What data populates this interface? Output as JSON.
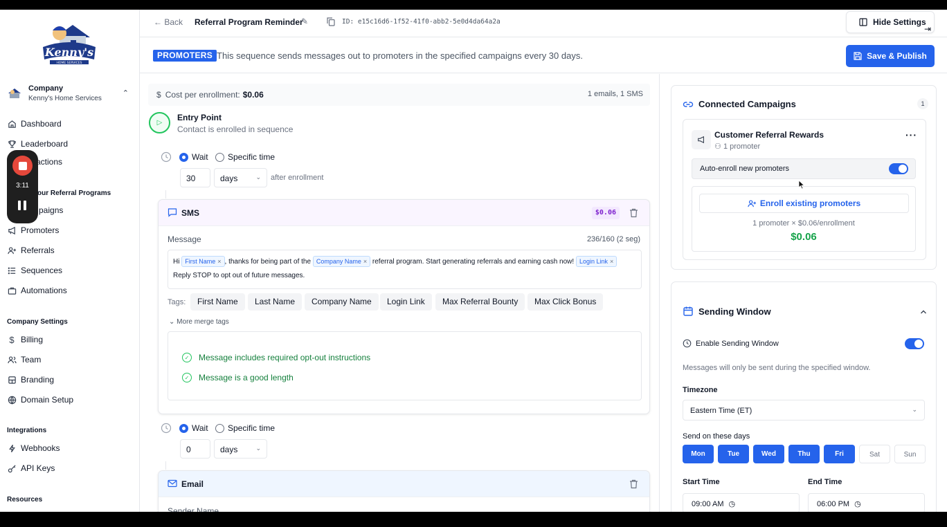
{
  "sidebar": {
    "company": {
      "label": "Company",
      "name": "Kenny's Home Services"
    },
    "nav": [
      {
        "label": "Dashboard",
        "icon": "home-icon"
      },
      {
        "label": "Leaderboard",
        "icon": "trophy-icon"
      },
      {
        "label": "sactions",
        "icon": "transactions-icon"
      },
      {
        "label": "paigns",
        "icon": "campaigns-icon"
      },
      {
        "label": "Promoters",
        "icon": "megaphone-icon"
      },
      {
        "label": "Referrals",
        "icon": "user-plus-icon"
      },
      {
        "label": "Sequences",
        "icon": "list-icon"
      },
      {
        "label": "Automations",
        "icon": "briefcase-icon"
      }
    ],
    "section_programs": "our Referral Programs",
    "section_company": "Company Settings",
    "company_nav": [
      {
        "label": "Billing",
        "icon": "dollar-icon"
      },
      {
        "label": "Team",
        "icon": "users-icon"
      },
      {
        "label": "Branding",
        "icon": "palette-icon"
      },
      {
        "label": "Domain Setup",
        "icon": "globe-icon"
      }
    ],
    "section_integrations": "Integrations",
    "integration_nav": [
      {
        "label": "Webhooks",
        "icon": "webhook-icon"
      },
      {
        "label": "API Keys",
        "icon": "key-icon"
      }
    ],
    "section_resources": "Resources"
  },
  "recorder": {
    "time": "3:11"
  },
  "topbar": {
    "back": "Back",
    "title": "Referral Program Reminder",
    "id": "ID: e15c16d6-1f52-41f0-abb2-5e0d4da64a2a",
    "hide_settings": "Hide Settings"
  },
  "info": {
    "badge": "PROMOTERS",
    "text": "This sequence sends messages out to promoters in the specified campaigns every 30 days.",
    "save": "Save & Publish"
  },
  "sequence": {
    "cost_label": "Cost per enrollment:",
    "cost_value": "$0.06",
    "counts": "1 emails, 1 SMS",
    "entry_title": "Entry Point",
    "entry_sub": "Contact is enrolled in sequence",
    "wait_label": "Wait",
    "specific_label": "Specific time",
    "wait1": {
      "value": "30",
      "unit": "days",
      "after": "after enrollment"
    },
    "wait2": {
      "value": "0",
      "unit": "days"
    },
    "sms": {
      "title": "SMS",
      "price": "$0.06",
      "message_label": "Message",
      "count": "236/160 (2 seg)",
      "msg_hi": "Hi",
      "chip_first": "First Name",
      "msg_part2": ", thanks for being part of the",
      "chip_company": "Company Name",
      "msg_part3": "referral program. Start generating referrals and earning cash now!",
      "chip_login": "Login Link",
      "msg_line2": "Reply STOP to opt out of future messages.",
      "chip_close": "×",
      "tags_label": "Tags:",
      "tags": [
        "First Name",
        "Last Name",
        "Company Name",
        "Login Link",
        "Max Referral Bounty",
        "Max Click Bonus"
      ],
      "more_tags": "More merge tags",
      "checks": [
        "Message includes required opt-out instructions",
        "Message is a good length"
      ]
    },
    "email": {
      "title": "Email",
      "sender_label": "Sender Name"
    }
  },
  "connected": {
    "title": "Connected Campaigns",
    "count": "1",
    "campaign_name": "Customer Referral Rewards",
    "campaign_sub": "1 promoter",
    "auto_enroll": "Auto-enroll new promoters",
    "enroll_btn": "Enroll existing promoters",
    "calc": "1 promoter × $0.06/enrollment",
    "total": "$0.06"
  },
  "sending": {
    "title": "Sending Window",
    "enable": "Enable Sending Window",
    "desc": "Messages will only be sent during the specified window.",
    "tz_label": "Timezone",
    "tz_value": "Eastern Time (ET)",
    "days_label": "Send on these days",
    "days": [
      {
        "label": "Mon",
        "on": true
      },
      {
        "label": "Tue",
        "on": true
      },
      {
        "label": "Wed",
        "on": true
      },
      {
        "label": "Thu",
        "on": true
      },
      {
        "label": "Fri",
        "on": true
      },
      {
        "label": "Sat",
        "on": false
      },
      {
        "label": "Sun",
        "on": false
      }
    ],
    "start_label": "Start Time",
    "start_value": "09:00 AM",
    "end_label": "End Time",
    "end_value": "06:00 PM"
  },
  "colors": {
    "primary": "#2563eb",
    "success": "#16a34a",
    "sms_bg": "#faf5ff",
    "email_bg": "#eff6ff"
  }
}
